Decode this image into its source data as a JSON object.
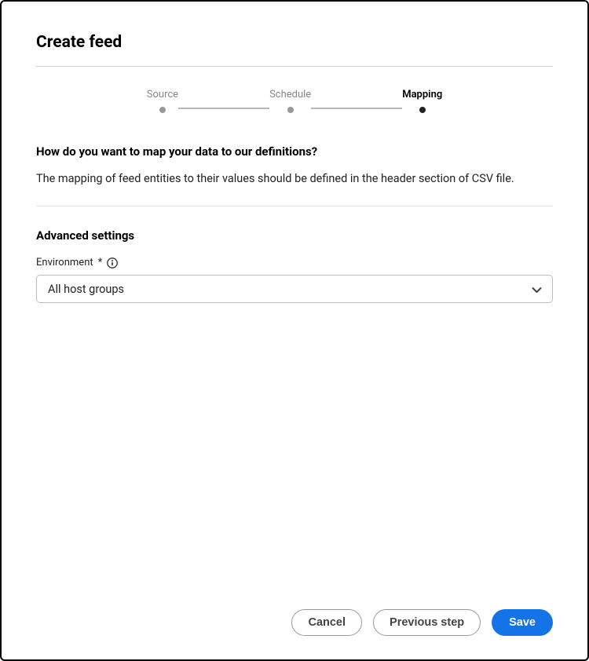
{
  "header": {
    "title": "Create feed"
  },
  "stepper": {
    "steps": [
      {
        "label": "Source",
        "active": false
      },
      {
        "label": "Schedule",
        "active": false
      },
      {
        "label": "Mapping",
        "active": true
      }
    ]
  },
  "main": {
    "question": "How do you want to map your data to our definitions?",
    "description": "The mapping of feed entities to their values should be defined in the header section of CSV file."
  },
  "advanced": {
    "heading": "Advanced settings",
    "environment": {
      "label": "Environment",
      "required_marker": "*",
      "selected": "All host groups"
    }
  },
  "footer": {
    "cancel": "Cancel",
    "previous": "Previous step",
    "save": "Save"
  }
}
